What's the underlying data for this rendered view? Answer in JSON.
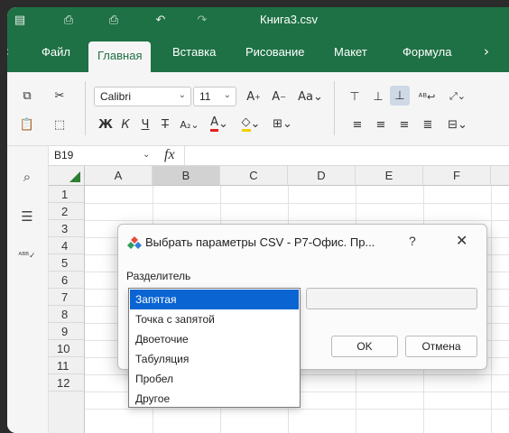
{
  "window": {
    "title": "Книга3.csv"
  },
  "menu": {
    "items": [
      {
        "label": "Файл"
      },
      {
        "label": "Главная"
      },
      {
        "label": "Вставка"
      },
      {
        "label": "Рисование"
      },
      {
        "label": "Макет"
      },
      {
        "label": "Формула"
      }
    ],
    "active": "Главная"
  },
  "ribbon": {
    "font_name": "Calibri",
    "font_size": "11"
  },
  "formula_bar": {
    "cell_ref": "B19",
    "fx_symbol": "fx",
    "formula": ""
  },
  "sheet": {
    "columns": [
      "A",
      "B",
      "C",
      "D",
      "E",
      "F"
    ],
    "rows": [
      "1",
      "2",
      "3",
      "4",
      "5",
      "6",
      "7",
      "8",
      "9",
      "10",
      "11",
      "12"
    ],
    "selected_column": "B"
  },
  "dialog": {
    "title": "Выбрать параметры CSV - Р7-Офис. Пр...",
    "help": "?",
    "delimiter_label": "Разделитель",
    "selected": "Запятая",
    "other_value": "",
    "ok_label": "OK",
    "cancel_label": "Отмена",
    "options": [
      {
        "label": "Запятая"
      },
      {
        "label": "Точка с запятой"
      },
      {
        "label": "Двоеточие"
      },
      {
        "label": "Табуляция"
      },
      {
        "label": "Пробел"
      },
      {
        "label": "Другое"
      }
    ]
  },
  "icons": {
    "accent_color": "#1e7145",
    "selection_color": "#0a64d2"
  }
}
